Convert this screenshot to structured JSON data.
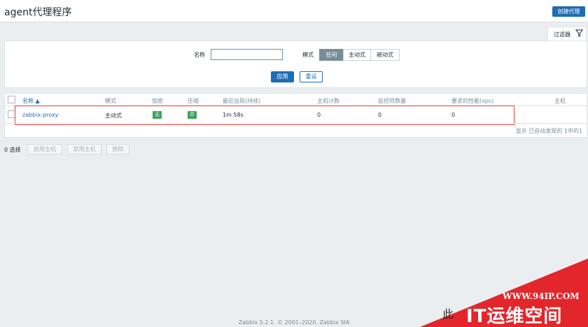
{
  "header": {
    "title": "agent代理程序",
    "create_button": "创建代理"
  },
  "filter": {
    "tab_label": "过滤器",
    "tab_icon": "filter-icon",
    "name_label": "名称",
    "name_value": "",
    "mode_label": "模式",
    "mode_options": [
      "任何",
      "主动式",
      "被动式"
    ],
    "mode_selected": "任何",
    "apply_button": "应用",
    "reset_button": "重设"
  },
  "table": {
    "columns": [
      "名称 ▲",
      "模式",
      "加密",
      "压缩",
      "最近出现(持续)",
      "主机计数",
      "监控项数量",
      "要求的性能(vps)",
      "主机"
    ],
    "rows": [
      {
        "name": "zabbix-proxy",
        "mode": "主动式",
        "encryption": "无",
        "compression": "开",
        "last_seen": "1m 58s",
        "host_count": "0",
        "item_count": "0",
        "required_performance": "0",
        "hosts": ""
      }
    ],
    "footer": "显示 已自动发现的 1中的1"
  },
  "actions": {
    "selected": "0 选择",
    "enable_hosts": "启用主机",
    "disable_hosts": "禁用主机",
    "delete": "删除"
  },
  "footer": {
    "copyright": "Zabbix 5.2.1. © 2001–2020, Zabbix SIA"
  },
  "watermark": {
    "url": "WWW.94IP.COM",
    "brand": "IT运维空间",
    "faint_text": "此"
  },
  "colors": {
    "primary": "#1e6db5",
    "badge_green": "#39a35a",
    "highlight_red": "#e03c3c",
    "watermark_red": "#e3262b"
  }
}
